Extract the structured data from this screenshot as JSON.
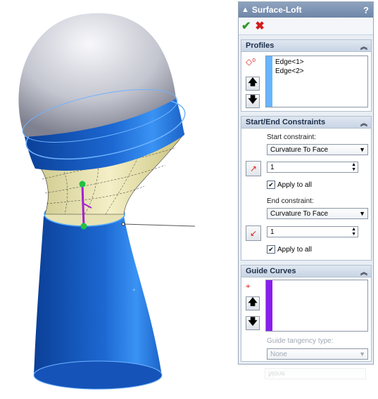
{
  "panel": {
    "title": "Surface-Loft",
    "help_label": "?",
    "ok_icon": "check-icon",
    "cancel_icon": "x-icon"
  },
  "profiles": {
    "header": "Profiles",
    "items": [
      "Edge<1>",
      "Edge<2>"
    ],
    "bar_color": "#66b5ff"
  },
  "constraints": {
    "header": "Start/End Constraints",
    "start_label": "Start constraint:",
    "start_value": "Curvature To Face",
    "start_number": "1",
    "start_apply_all": "Apply to all",
    "end_label": "End constraint:",
    "end_value": "Curvature To Face",
    "end_number": "1",
    "end_apply_all": "Apply to all"
  },
  "guide": {
    "header": "Guide Curves",
    "bar_color": "#8b1df0",
    "tangency_label": "Guide tangency type:",
    "tangency_value": "None"
  },
  "reflection_text": "None",
  "colors": {
    "accent_blue": "#1b62c7",
    "loft_yellow": "#f0ecc0",
    "dome_gray": "#c7c9d1"
  }
}
